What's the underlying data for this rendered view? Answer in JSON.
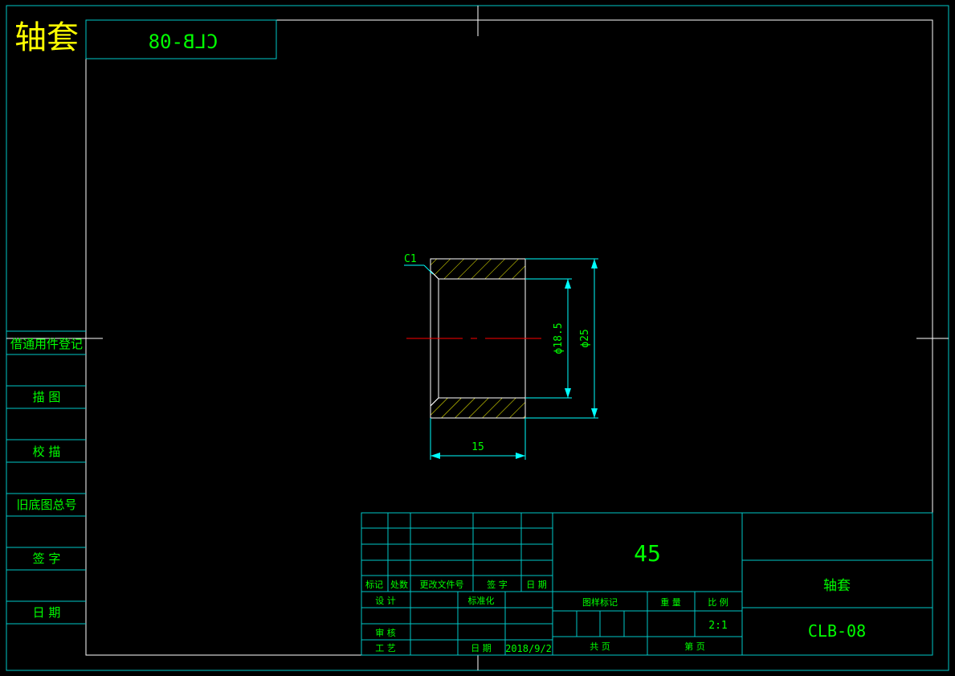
{
  "header": {
    "part_name": "轴套",
    "drawing_number_mirrored": "CLB-08"
  },
  "colors": {
    "background": "#000000",
    "frame_line": "#00c8c8",
    "border_line": "#ffffff",
    "text_green": "#00ff00",
    "text_yellow": "#ffff00",
    "dimension": "#00ffff",
    "hatch": "#ffff00",
    "centerline": "#ff0000"
  },
  "side_column": {
    "labels": [
      "借通用件登记",
      "描 图",
      "校 描",
      "旧底图总号",
      "签 字",
      "日 期"
    ]
  },
  "part_view": {
    "chamfer_label": "C1",
    "length_dim": "15",
    "inner_dia_dim": "ϕ18.5",
    "outer_dia_dim": "ϕ25"
  },
  "title_block": {
    "material": "45",
    "part_name": "轴套",
    "drawing_number": "CLB-08",
    "revision_headers": [
      "标记",
      "处数",
      "更改文件号",
      "签 字",
      "日 期"
    ],
    "design_label": "设 计",
    "standardization_label": "标准化",
    "review_label": "审 核",
    "process_label": "工 艺",
    "date_label": "日 期",
    "date_value": "2018/9/2",
    "stage_mark_label": "图样标记",
    "weight_label": "重 量",
    "scale_label": "比 例",
    "scale_value": "2:1",
    "total_sheets_label": "共    页",
    "sheet_label": "第    页"
  }
}
